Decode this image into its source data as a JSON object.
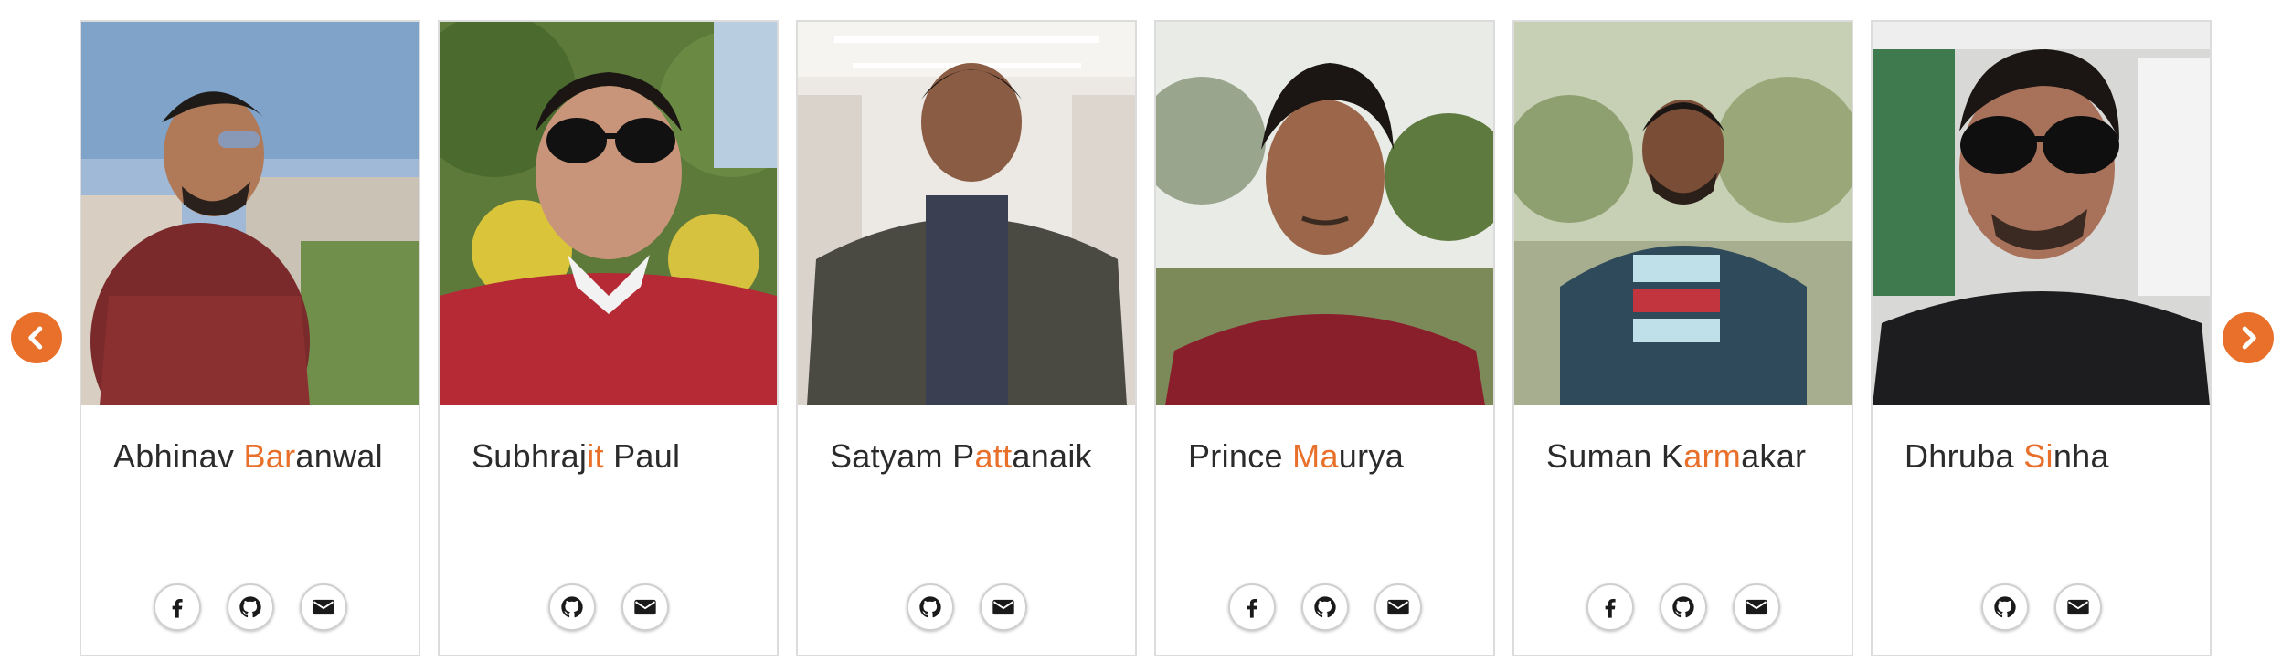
{
  "navigation": {
    "prev_icon": "chevron-left-icon",
    "next_icon": "chevron-right-icon",
    "accent_color": "#e8702a"
  },
  "team": [
    {
      "name_pre": "Abhinav ",
      "name_hl": "Bar",
      "name_post": "anwal",
      "socials": [
        "facebook",
        "github",
        "email"
      ]
    },
    {
      "name_pre": "Subhraj",
      "name_hl": "it",
      "name_post": " Paul",
      "socials": [
        "github",
        "email"
      ]
    },
    {
      "name_pre": "Satyam P",
      "name_hl": "att",
      "name_post": "anaik",
      "socials": [
        "github",
        "email"
      ]
    },
    {
      "name_pre": "Prince ",
      "name_hl": "Ma",
      "name_post": "urya",
      "socials": [
        "facebook",
        "github",
        "email"
      ]
    },
    {
      "name_pre": "Suman K",
      "name_hl": "arm",
      "name_post": "akar",
      "socials": [
        "facebook",
        "github",
        "email"
      ]
    },
    {
      "name_pre": "Dhruba ",
      "name_hl": "Si",
      "name_post": "nha",
      "socials": [
        "github",
        "email"
      ]
    }
  ]
}
